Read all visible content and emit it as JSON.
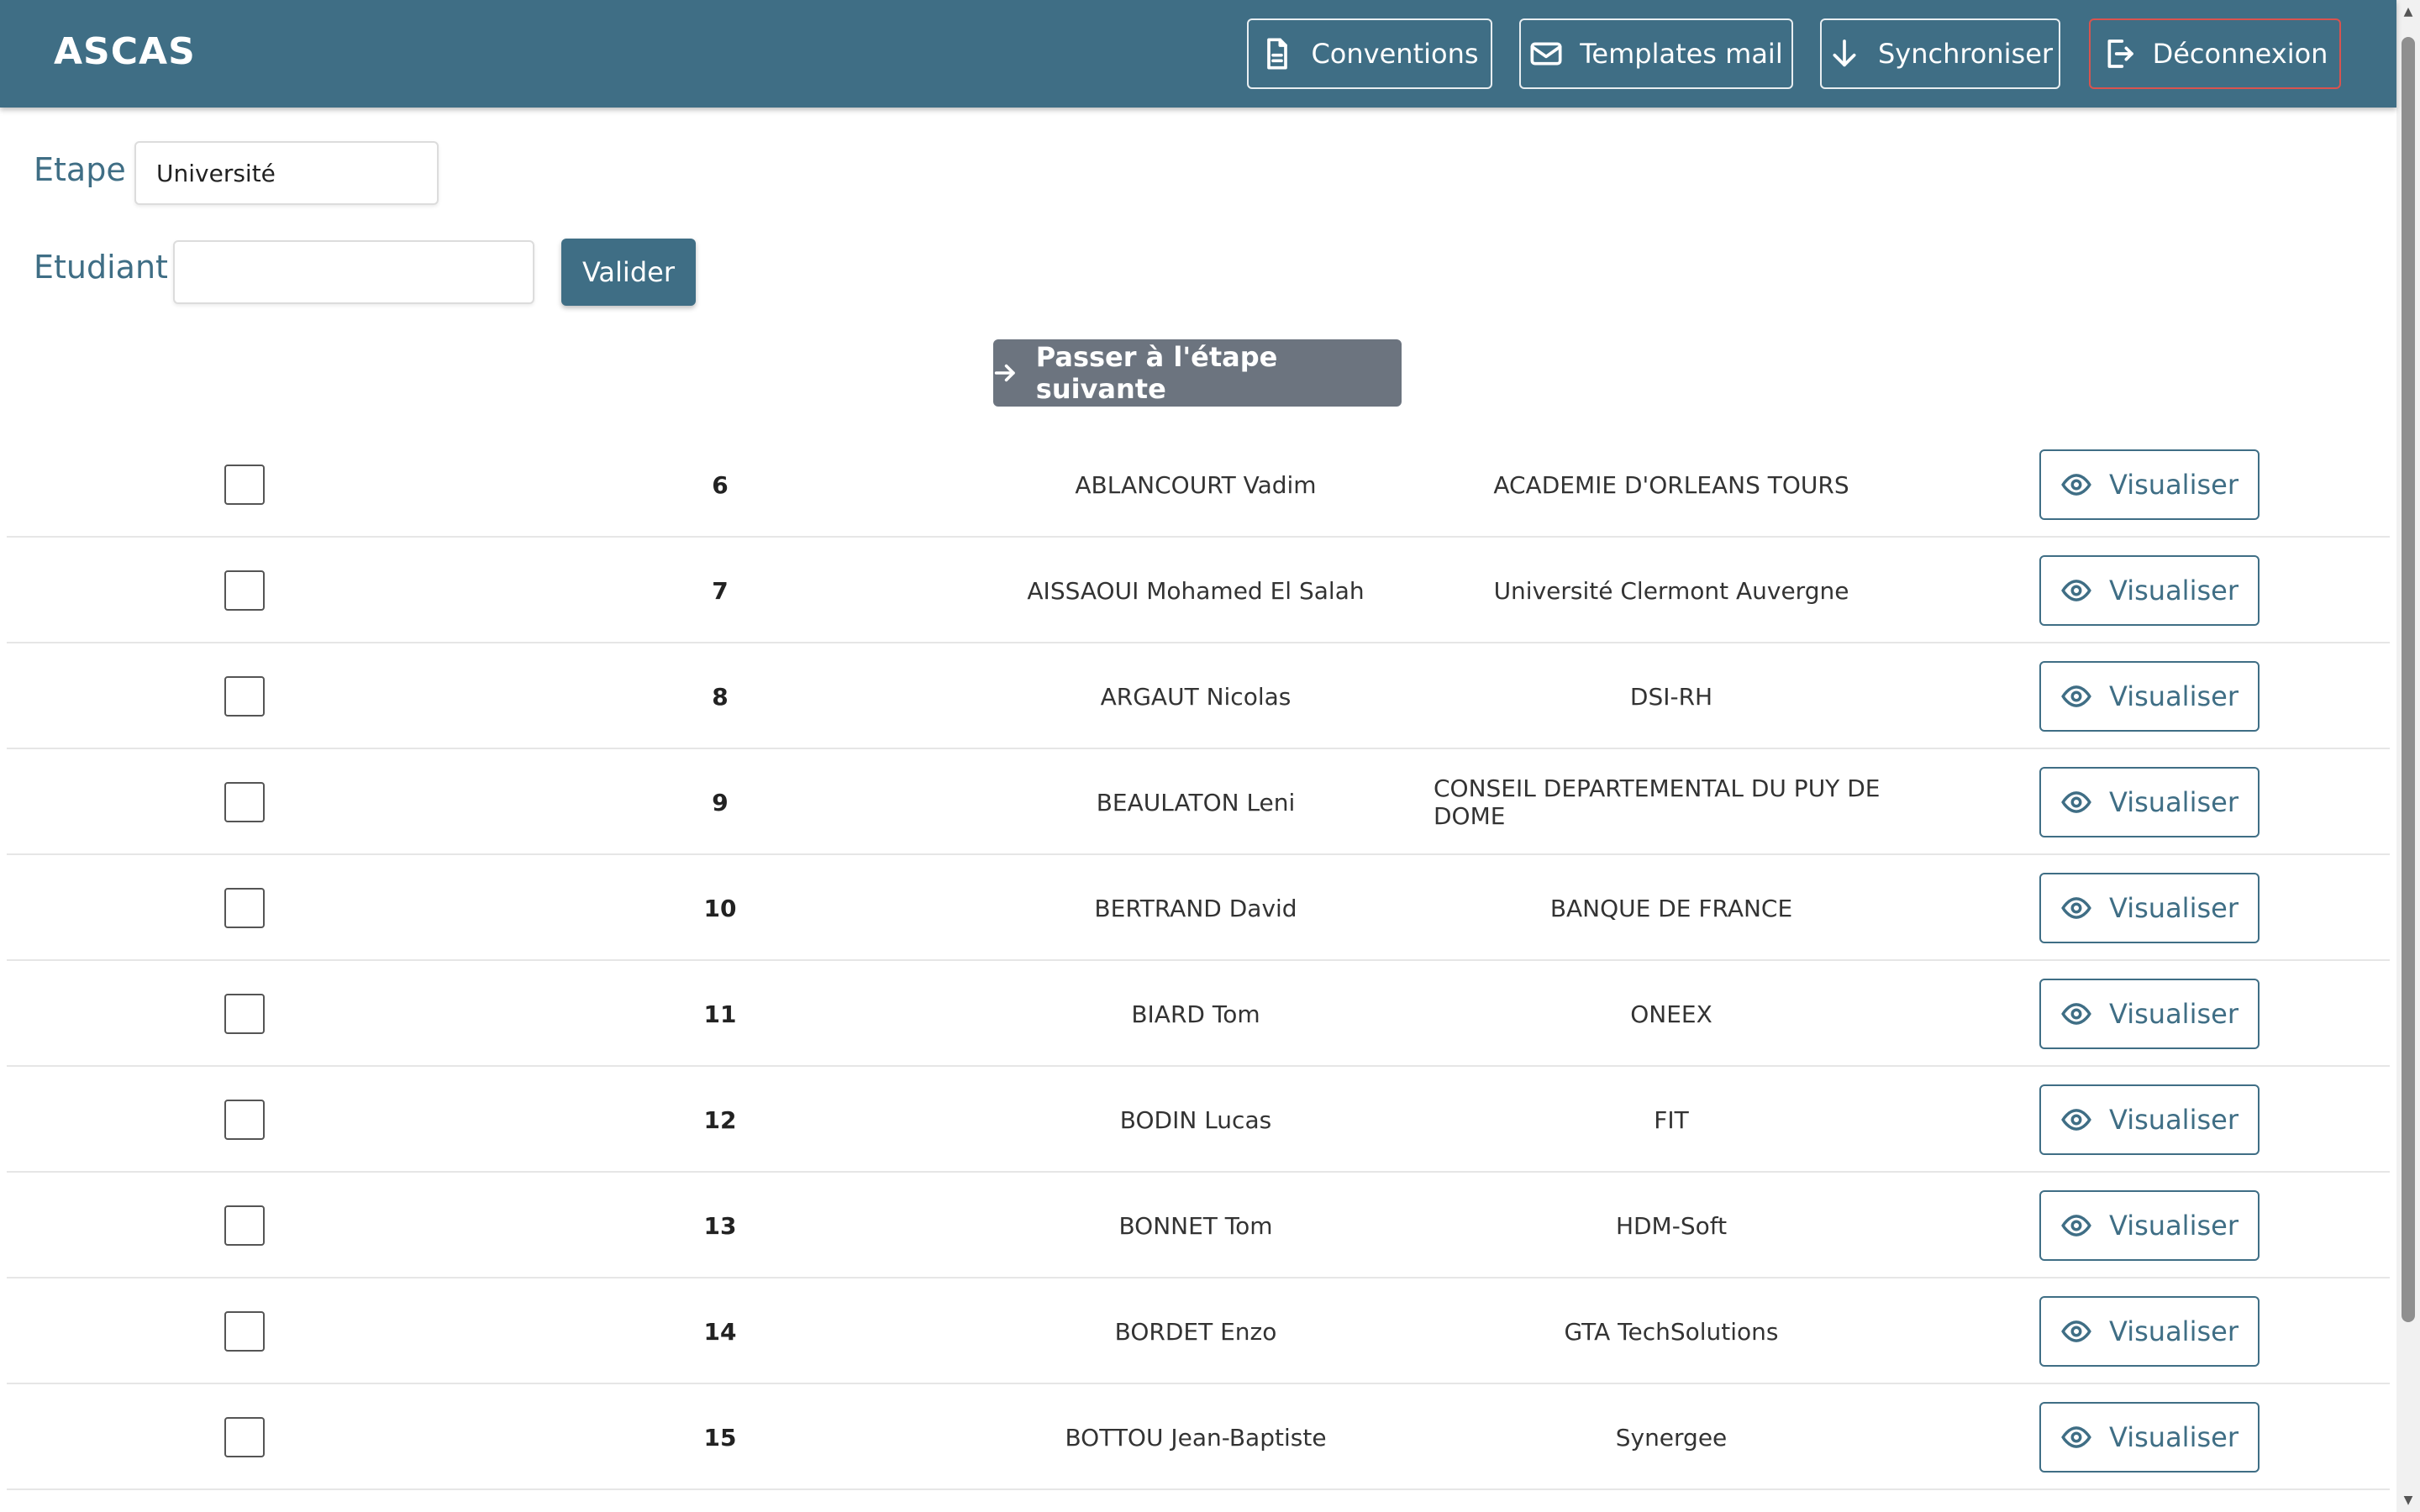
{
  "app": {
    "title": "ASCAS"
  },
  "header": {
    "buttons": [
      {
        "label": "Conventions",
        "icon": "document-icon"
      },
      {
        "label": "Templates mail",
        "icon": "envelope-icon"
      },
      {
        "label": "Synchroniser",
        "icon": "arrow-down-icon"
      },
      {
        "label": "Déconnexion",
        "icon": "logout-icon"
      }
    ]
  },
  "filters": {
    "etape_label": "Etape :",
    "etape_value": "Université",
    "etudiant_label": "Etudiant :",
    "etudiant_value": "",
    "validate_label": "Valider"
  },
  "next_step": {
    "label": "Passer à l'étape suivante",
    "icon": "arrow-right-icon"
  },
  "colors": {
    "primary": "#3f6e85",
    "danger": "#d9534f",
    "secondary": "#6c747f"
  },
  "rows": [
    {
      "num": "6",
      "name": "ABLANCOURT Vadim",
      "org": "ACADEMIE D'ORLEANS TOURS",
      "action": "Visualiser"
    },
    {
      "num": "7",
      "name": "AISSAOUI Mohamed El Salah",
      "org": "Université Clermont Auvergne",
      "action": "Visualiser"
    },
    {
      "num": "8",
      "name": "ARGAUT Nicolas",
      "org": "DSI-RH",
      "action": "Visualiser"
    },
    {
      "num": "9",
      "name": "BEAULATON Leni",
      "org": "CONSEIL DEPARTEMENTAL DU PUY DE DOME",
      "action": "Visualiser"
    },
    {
      "num": "10",
      "name": "BERTRAND David",
      "org": "BANQUE DE FRANCE",
      "action": "Visualiser"
    },
    {
      "num": "11",
      "name": "BIARD Tom",
      "org": "ONEEX",
      "action": "Visualiser"
    },
    {
      "num": "12",
      "name": "BODIN Lucas",
      "org": "FIT",
      "action": "Visualiser"
    },
    {
      "num": "13",
      "name": "BONNET Tom",
      "org": "HDM-Soft",
      "action": "Visualiser"
    },
    {
      "num": "14",
      "name": "BORDET Enzo",
      "org": "GTA TechSolutions",
      "action": "Visualiser"
    },
    {
      "num": "15",
      "name": "BOTTOU Jean-Baptiste",
      "org": "Synergee",
      "action": "Visualiser"
    }
  ]
}
